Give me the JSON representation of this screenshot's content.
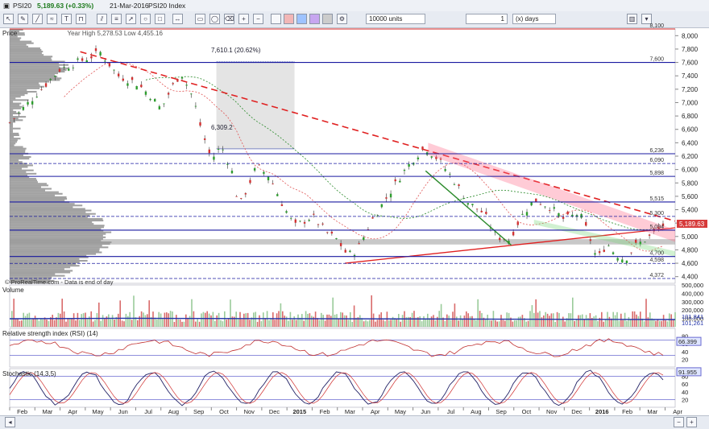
{
  "header": {
    "symbol": "PSI20",
    "price_change": "5,189.63 (+0.33%)",
    "date": "21-Mar-2016",
    "index_name": "PSI20 Index"
  },
  "toolbar": {
    "units_value": "10000 units",
    "period_count": "1",
    "period_unit": "(x) days"
  },
  "panels": {
    "price": {
      "label": "Price",
      "hilo": "Year High 5,278.53 Low 4,455.16",
      "note": "© ProRealTime.com - Data is end of day"
    },
    "volume": {
      "label": "Volume"
    },
    "rsi": {
      "label": "Relative strength index (RSI) (14)"
    },
    "stoch": {
      "label": "Stochastic (14,3,5)"
    }
  },
  "annotations": {
    "range_top": "7,610.1 (20.62%)",
    "range_bottom": "6,309.2"
  },
  "chart_data": [
    {
      "type": "candlestick",
      "title": "PSI20 Index",
      "ylim": [
        4300,
        8100
      ],
      "y_ticks": [
        "8,000",
        "7,800",
        "7,600",
        "7,400",
        "7,200",
        "7,000",
        "6,800",
        "6,600",
        "6,400",
        "6,200",
        "6,000",
        "5,800",
        "5,600",
        "5,400",
        "5,200",
        "5,000",
        "4,800",
        "4,600",
        "4,400"
      ],
      "x_labels": [
        "Feb",
        "Mar",
        "Apr",
        "May",
        "Jun",
        "Jul",
        "Aug",
        "Sep",
        "Oct",
        "Nov",
        "Dec",
        "2015",
        "Feb",
        "Mar",
        "Apr",
        "May",
        "Jun",
        "Jul",
        "Aug",
        "Sep",
        "Oct",
        "Nov",
        "Dec",
        "2016",
        "Feb",
        "Mar",
        "Apr"
      ],
      "last_price": "5,189.63",
      "horizontal_levels": [
        {
          "value": 8100,
          "label": "8,100"
        },
        {
          "value": 7600,
          "label": "7,600"
        },
        {
          "value": 6236,
          "label": "6,236"
        },
        {
          "value": 6090,
          "label": "6,090"
        },
        {
          "value": 5898,
          "label": "5,898"
        },
        {
          "value": 5515,
          "label": "5,515"
        },
        {
          "value": 5300,
          "label": "5,300"
        },
        {
          "value": 5094,
          "label": "5,094"
        },
        {
          "value": 4700,
          "label": "4,700"
        },
        {
          "value": 4598,
          "label": "4,598"
        },
        {
          "value": 4372,
          "label": "4,372"
        }
      ],
      "close_path": [
        [
          0,
          6700
        ],
        [
          1,
          7100
        ],
        [
          2,
          7500
        ],
        [
          3,
          7650
        ],
        [
          3.6,
          7750
        ],
        [
          4.3,
          7400
        ],
        [
          5,
          7300
        ],
        [
          5.6,
          7100
        ],
        [
          6,
          6900
        ],
        [
          6.4,
          7200
        ],
        [
          6.8,
          7450
        ],
        [
          7.3,
          7050
        ],
        [
          7.6,
          6600
        ],
        [
          8,
          6150
        ],
        [
          8.4,
          6350
        ],
        [
          8.8,
          6000
        ],
        [
          9.1,
          5450
        ],
        [
          9.4,
          5700
        ],
        [
          9.8,
          6050
        ],
        [
          10.3,
          5900
        ],
        [
          10.8,
          5500
        ],
        [
          11.3,
          5150
        ],
        [
          12,
          5300
        ],
        [
          12.6,
          5050
        ],
        [
          13,
          4950
        ],
        [
          13.4,
          4720
        ],
        [
          13.8,
          4800
        ],
        [
          14.3,
          5200
        ],
        [
          14.9,
          5550
        ],
        [
          15.5,
          5900
        ],
        [
          16.1,
          6200
        ],
        [
          16.5,
          6330
        ],
        [
          17,
          6150
        ],
        [
          17.6,
          5850
        ],
        [
          18.2,
          5500
        ],
        [
          18.8,
          5350
        ],
        [
          19.3,
          5000
        ],
        [
          19.8,
          4950
        ],
        [
          20.3,
          5300
        ],
        [
          20.8,
          5550
        ],
        [
          21.4,
          5450
        ],
        [
          22,
          5250
        ],
        [
          22.6,
          5350
        ],
        [
          23,
          5000
        ],
        [
          23.3,
          4650
        ],
        [
          23.7,
          4900
        ],
        [
          24,
          4750
        ],
        [
          24.4,
          4650
        ],
        [
          24.8,
          4850
        ],
        [
          25.4,
          5000
        ],
        [
          26,
          5190
        ]
      ],
      "volume_ylim": [
        0,
        500000
      ],
      "volume_ticks": [
        "500,000",
        "400,000",
        "300,000",
        "200,000",
        "100,000"
      ],
      "volume_last": "101,841",
      "volume_ma": "101,261",
      "rsi_ticks": [
        "80",
        "60",
        "40",
        "20"
      ],
      "rsi_last": "66.399",
      "stoch_ticks": [
        "80",
        "60",
        "40",
        "20"
      ],
      "stoch_last": "91.955"
    }
  ]
}
